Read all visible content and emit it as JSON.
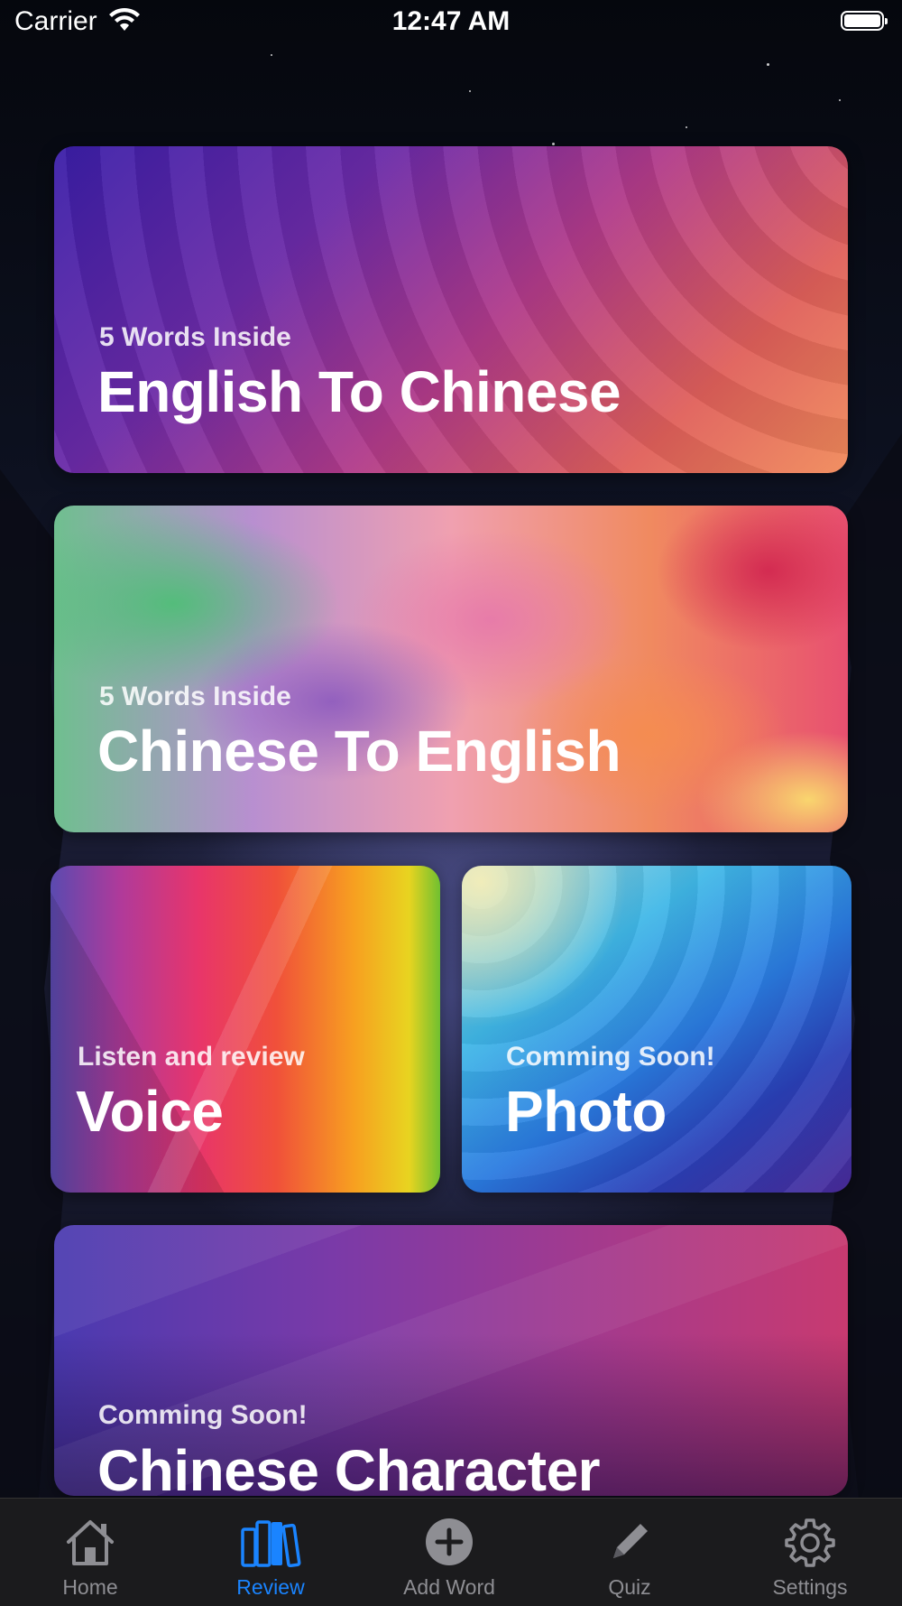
{
  "status_bar": {
    "carrier": "Carrier",
    "time": "12:47 AM"
  },
  "cards": {
    "english_to_chinese": {
      "subtitle": "5 Words Inside",
      "title": "English To Chinese"
    },
    "chinese_to_english": {
      "subtitle": "5 Words Inside",
      "title": "Chinese To English"
    },
    "voice": {
      "subtitle": "Listen and review",
      "title": "Voice"
    },
    "photo": {
      "subtitle": "Comming Soon!",
      "title": "Photo"
    },
    "chinese_character": {
      "subtitle": "Comming Soon!",
      "title": "Chinese Character"
    }
  },
  "tab_bar": {
    "active": "review",
    "accent_color": "#1a84ff",
    "inactive_color": "#8e8e93",
    "tabs": [
      {
        "id": "home",
        "label": "Home",
        "icon": "house-icon"
      },
      {
        "id": "review",
        "label": "Review",
        "icon": "books-icon"
      },
      {
        "id": "add_word",
        "label": "Add Word",
        "icon": "plus-circle-icon"
      },
      {
        "id": "quiz",
        "label": "Quiz",
        "icon": "pencil-icon"
      },
      {
        "id": "settings",
        "label": "Settings",
        "icon": "gear-icon"
      }
    ]
  }
}
